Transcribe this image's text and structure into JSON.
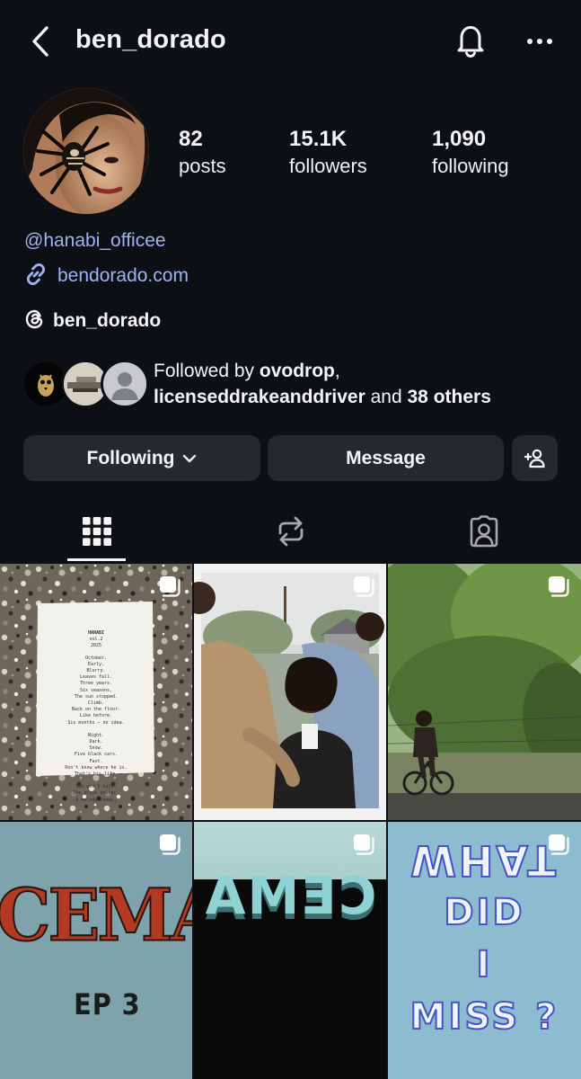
{
  "header": {
    "username": "ben_dorado"
  },
  "stats": {
    "posts": {
      "count": "82",
      "label": "posts"
    },
    "followers": {
      "count": "15.1K",
      "label": "followers"
    },
    "following": {
      "count": "1,090",
      "label": "following"
    }
  },
  "bio": {
    "mention": "@hanabi_officee",
    "link": "bendorado.com",
    "threads": "ben_dorado"
  },
  "followed_by": {
    "prefix": "Followed by ",
    "user1": "ovodrop",
    "sep": ",",
    "user2": "licenseddrakeanddriver",
    "and_text": " and ",
    "others": "38 others"
  },
  "buttons": {
    "following": "Following",
    "message": "Message"
  },
  "tabs": [
    "posts-grid",
    "reposts",
    "tagged"
  ],
  "grid": {
    "note": {
      "title": "HANABI",
      "vol": "vol.2",
      "year": "2025",
      "lines": [
        "October.",
        "Early.",
        "Blurry.",
        "Leaves fall.",
        "Three years.",
        "Six seasons.",
        "The sun stopped.",
        "Climb.",
        "Back on the floor.",
        "Like before.",
        "Six months — no idea.",
        "",
        "Night.",
        "Dark.",
        "Snow.",
        "Five black cars.",
        "Fast.",
        "Don't know where he is.",
        "That's his life.",
        "",
        "She won't talk.",
        "She plays guitar.",
        "A melody comes."
      ]
    },
    "cema_text": "CEMA",
    "ep_text": "EP 3",
    "mirror_text": "CEMA",
    "what_lines": [
      "WHAT",
      "DID",
      "I",
      "MISS ?"
    ]
  },
  "colors": {
    "background": "#0c1014",
    "link": "#a0b2f3",
    "button": "#25292e"
  }
}
